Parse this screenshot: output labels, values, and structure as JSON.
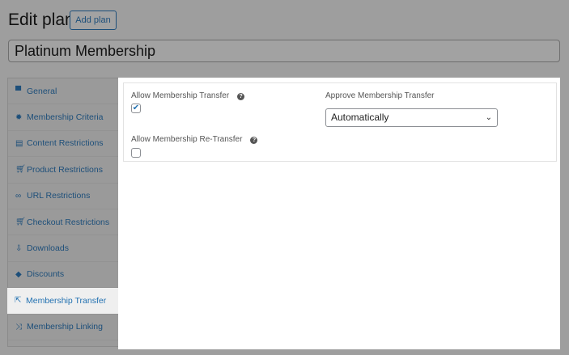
{
  "header": {
    "title": "Edit plan",
    "add_label": "Add plan",
    "plan_name": "Platinum Membership"
  },
  "sidebar": {
    "items": [
      {
        "label": "General",
        "icon": "store-icon"
      },
      {
        "label": "Membership Criteria",
        "icon": "gear-icon"
      },
      {
        "label": "Content Restrictions",
        "icon": "document-icon"
      },
      {
        "label": "Product Restrictions",
        "icon": "cart-icon"
      },
      {
        "label": "URL Restrictions",
        "icon": "link-icon"
      },
      {
        "label": "Checkout Restrictions",
        "icon": "cart-icon"
      },
      {
        "label": "Downloads",
        "icon": "download-icon"
      },
      {
        "label": "Discounts",
        "icon": "tag-icon"
      },
      {
        "label": "Membership Transfer",
        "icon": "transfer-icon",
        "active": true
      },
      {
        "label": "Membership Linking",
        "icon": "linking-icon"
      }
    ]
  },
  "panel": {
    "allow_transfer_label": "Allow Membership Transfer",
    "allow_transfer_checked": true,
    "approve_label": "Approve Membership Transfer",
    "approve_value": "Automatically",
    "allow_retransfer_label": "Allow Membership Re-Transfer",
    "allow_retransfer_checked": false
  }
}
